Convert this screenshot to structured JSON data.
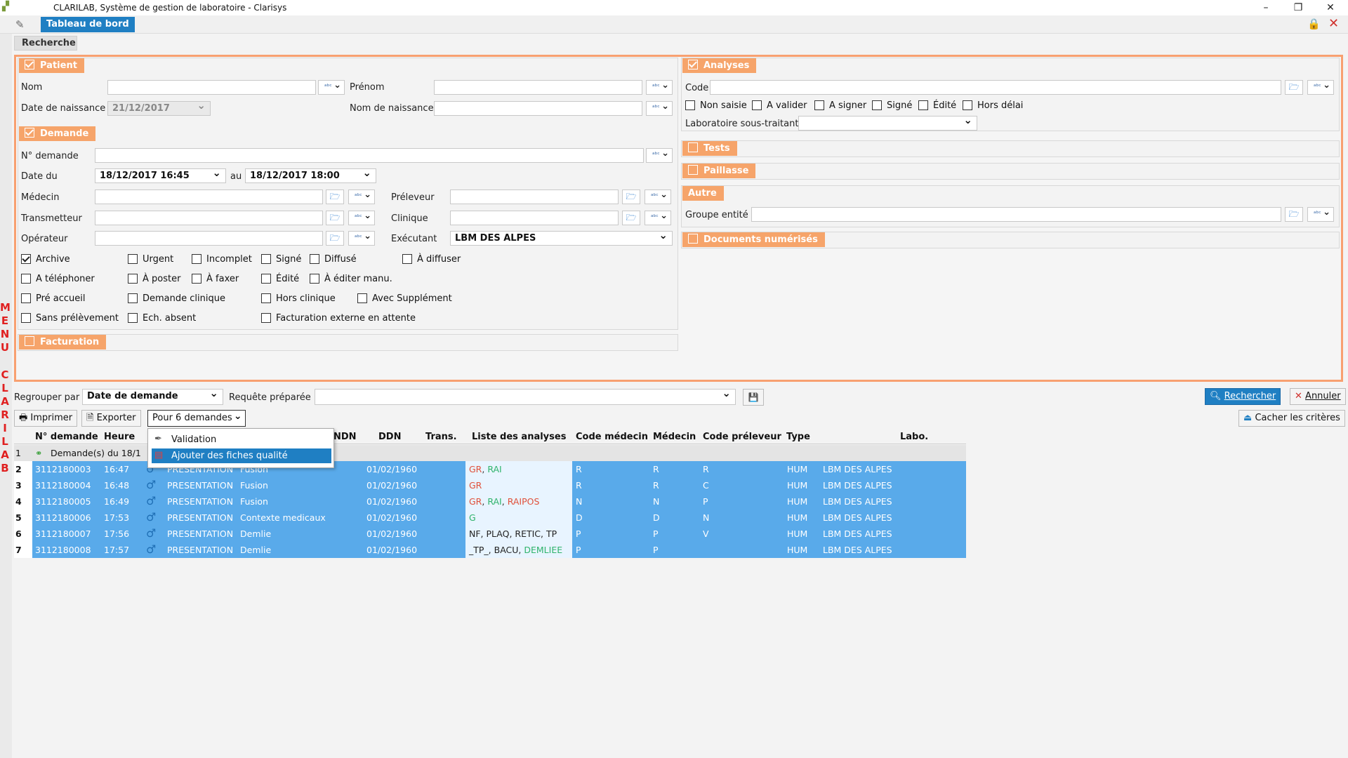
{
  "window": {
    "title": "CLARILAB, Système de gestion de laboratoire - Clarisys",
    "minimize": "–",
    "maximize": "❐",
    "close": "✕"
  },
  "tab": {
    "label": "Tableau de bord"
  },
  "side_menu": [
    "M",
    "E",
    "N",
    "U",
    "C",
    "L",
    "A",
    "R",
    "I",
    "L",
    "A",
    "B"
  ],
  "search_tab": "Recherche",
  "patient": {
    "title": "Patient",
    "nom": "Nom",
    "prenom": "Prénom",
    "date_naissance": "Date de naissance",
    "date_naissance_value": "21/12/2017",
    "nom_naissance": "Nom de naissance"
  },
  "demande": {
    "title": "Demande",
    "num": "N° demande",
    "date_du": "Date du",
    "date_from": "18/12/2017 16:45",
    "au": "au",
    "date_to": "18/12/2017 18:00",
    "medecin": "Médecin",
    "preleveur": "Préleveur",
    "transmetteur": "Transmetteur",
    "clinique": "Clinique",
    "operateur": "Opérateur",
    "executant": "Exécutant",
    "executant_value": "LBM DES ALPES",
    "checks": [
      {
        "label": "Archive",
        "checked": true
      },
      {
        "label": "Urgent",
        "checked": false
      },
      {
        "label": "Incomplet",
        "checked": false
      },
      {
        "label": "Signé",
        "checked": false
      },
      {
        "label": "Diffusé",
        "checked": false
      },
      {
        "label": "À diffuser",
        "checked": false
      },
      {
        "label": "A téléphoner",
        "checked": false
      },
      {
        "label": "À poster",
        "checked": false
      },
      {
        "label": "À faxer",
        "checked": false
      },
      {
        "label": "Édité",
        "checked": false
      },
      {
        "label": "À éditer manu.",
        "checked": false
      },
      {
        "label": "Pré accueil",
        "checked": false
      },
      {
        "label": "Demande clinique",
        "checked": false
      },
      {
        "label": "Hors clinique",
        "checked": false
      },
      {
        "label": "Avec Supplément",
        "checked": false
      },
      {
        "label": "Sans prélèvement",
        "checked": false
      },
      {
        "label": "Ech. absent",
        "checked": false
      },
      {
        "label": "Facturation externe en attente",
        "checked": false
      }
    ]
  },
  "facturation": {
    "title": "Facturation"
  },
  "analyses": {
    "title": "Analyses",
    "code": "Code",
    "checks": [
      "Non saisie",
      "A valider",
      "A signer",
      "Signé",
      "Édité",
      "Hors délai"
    ],
    "labo_sous": "Laboratoire sous-traitant"
  },
  "tests": {
    "title": "Tests"
  },
  "paillasse": {
    "title": "Paillasse"
  },
  "autre": {
    "title": "Autre",
    "groupe": "Groupe entité"
  },
  "documents": {
    "title": "Documents numérisés"
  },
  "toolbar": {
    "regrouper": "Regrouper par",
    "regrouper_value": "Date de demande",
    "requete": "Requête préparée",
    "rechercher": "Rechercher",
    "annuler": "Annuler",
    "imprimer": "Imprimer",
    "exporter": "Exporter",
    "pour": "Pour 6 demandes",
    "cacher": "Cacher les critères"
  },
  "menu": {
    "items": [
      "Validation",
      "Ajouter des fiches qualité"
    ]
  },
  "grid": {
    "headers": [
      "N° demande",
      "Heure",
      "NDN",
      "DDN",
      "Trans.",
      "Liste des analyses",
      "Code médecin",
      "Médecin",
      "Code préleveur",
      "Type",
      "Labo."
    ],
    "group": {
      "num": "1",
      "label": "Demande(s) du 18/1"
    },
    "rows": [
      {
        "n": "2",
        "num": "3112180003",
        "heure": "16:47",
        "nom": "PRESENTATION",
        "prenom": "Fusion",
        "ddn": "01/02/1960",
        "an": [
          {
            "t": "GR",
            "c": "#e0503a"
          },
          {
            "t": ", ",
            "c": "#333"
          },
          {
            "t": "RAI",
            "c": "#2fb36b"
          }
        ],
        "cm": "R",
        "med": "R",
        "cp": "R",
        "type": "HUM",
        "labo": "LBM DES ALPES"
      },
      {
        "n": "3",
        "num": "3112180004",
        "heure": "16:48",
        "nom": "PRESENTATION",
        "prenom": "Fusion",
        "ddn": "01/02/1960",
        "an": [
          {
            "t": "GR",
            "c": "#e0503a"
          }
        ],
        "cm": "R",
        "med": "R",
        "cp": "C",
        "type": "HUM",
        "labo": "LBM DES ALPES"
      },
      {
        "n": "4",
        "num": "3112180005",
        "heure": "16:49",
        "nom": "PRESENTATION",
        "prenom": "Fusion",
        "ddn": "01/02/1960",
        "an": [
          {
            "t": "GR",
            "c": "#e0503a"
          },
          {
            "t": ", ",
            "c": "#333"
          },
          {
            "t": "RAI",
            "c": "#2fb36b"
          },
          {
            "t": ", ",
            "c": "#333"
          },
          {
            "t": "RAIPOS",
            "c": "#e0503a"
          }
        ],
        "cm": "N",
        "med": "N",
        "cp": "P",
        "type": "HUM",
        "labo": "LBM DES ALPES"
      },
      {
        "n": "5",
        "num": "3112180006",
        "heure": "17:53",
        "nom": "PRESENTATION",
        "prenom": "Contexte medicaux",
        "ddn": "01/02/1960",
        "an": [
          {
            "t": "G",
            "c": "#2fb36b"
          }
        ],
        "cm": "D",
        "med": "D",
        "cp": "N",
        "type": "HUM",
        "labo": "LBM DES ALPES"
      },
      {
        "n": "6",
        "num": "3112180007",
        "heure": "17:56",
        "nom": "PRESENTATION",
        "prenom": "Demlie",
        "ddn": "01/02/1960",
        "an": [
          {
            "t": "NF, PLAQ, RETIC, TP",
            "c": "#222"
          }
        ],
        "cm": "P",
        "med": "P",
        "cp": "V",
        "type": "HUM",
        "labo": "LBM DES ALPES"
      },
      {
        "n": "7",
        "num": "3112180008",
        "heure": "17:57",
        "nom": "PRESENTATION",
        "prenom": "Demlie",
        "ddn": "01/02/1960",
        "an": [
          {
            "t": "_TP_, BACU, ",
            "c": "#222"
          },
          {
            "t": "DEMLIEE",
            "c": "#2fb36b"
          }
        ],
        "cm": "P",
        "med": "P",
        "cp": "",
        "type": "HUM",
        "labo": "LBM DES ALPES"
      }
    ]
  },
  "colors": {
    "accent": "#1f7fc3",
    "section": "#f6a46a",
    "selection": "#59aaea",
    "menu_letters": "#e02020"
  }
}
